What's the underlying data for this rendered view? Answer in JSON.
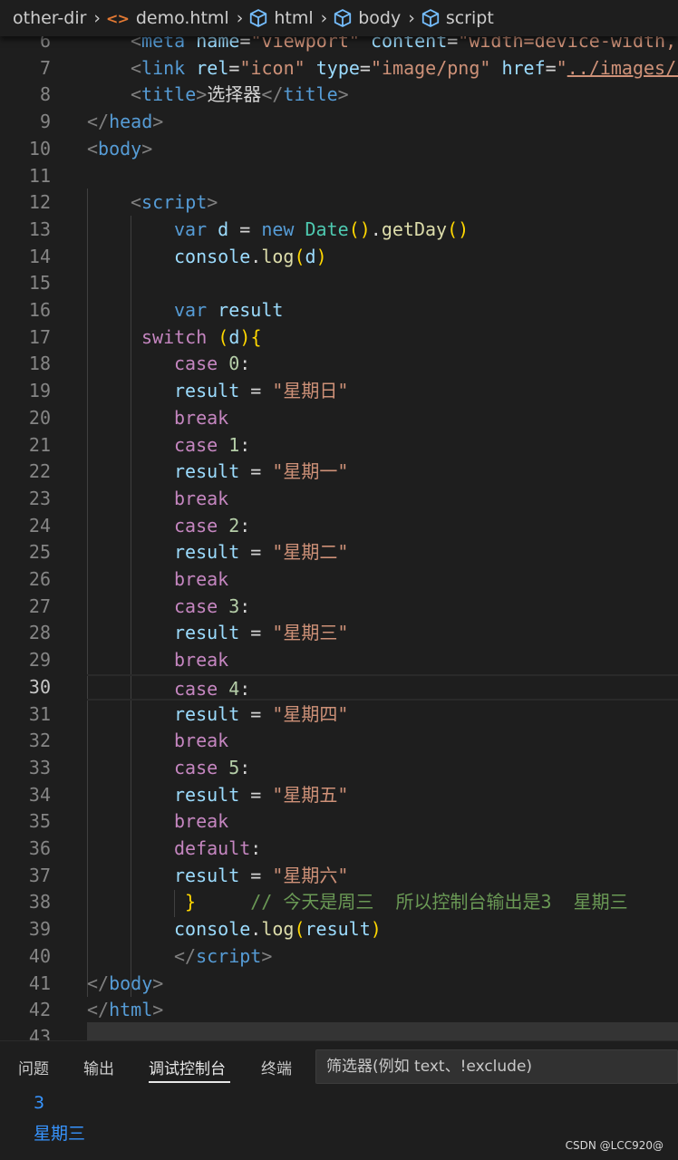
{
  "breadcrumb": {
    "items": [
      {
        "label": "other-dir",
        "icon": "none"
      },
      {
        "label": "demo.html",
        "icon": "html-file-icon"
      },
      {
        "label": "html",
        "icon": "symbol-cube-icon"
      },
      {
        "label": "body",
        "icon": "symbol-cube-icon"
      },
      {
        "label": "script",
        "icon": "symbol-cube-icon"
      }
    ]
  },
  "editor": {
    "current_line": 30,
    "lines": [
      {
        "n": "6"
      },
      {
        "n": "7"
      },
      {
        "n": "8"
      },
      {
        "n": "9"
      },
      {
        "n": "10"
      },
      {
        "n": "11"
      },
      {
        "n": "12"
      },
      {
        "n": "13"
      },
      {
        "n": "14"
      },
      {
        "n": "15"
      },
      {
        "n": "16"
      },
      {
        "n": "17"
      },
      {
        "n": "18"
      },
      {
        "n": "19"
      },
      {
        "n": "20"
      },
      {
        "n": "21"
      },
      {
        "n": "22"
      },
      {
        "n": "23"
      },
      {
        "n": "24"
      },
      {
        "n": "25"
      },
      {
        "n": "26"
      },
      {
        "n": "27"
      },
      {
        "n": "28"
      },
      {
        "n": "29"
      },
      {
        "n": "30"
      },
      {
        "n": "31"
      },
      {
        "n": "32"
      },
      {
        "n": "33"
      },
      {
        "n": "34"
      },
      {
        "n": "35"
      },
      {
        "n": "36"
      },
      {
        "n": "37"
      },
      {
        "n": "38"
      },
      {
        "n": "39"
      },
      {
        "n": "40"
      },
      {
        "n": "41"
      },
      {
        "n": "42"
      },
      {
        "n": "43"
      }
    ],
    "tokens": {
      "l6": [
        [
          "t-br",
          "<"
        ],
        [
          "t-tag",
          "meta"
        ],
        [
          "t-pl",
          " "
        ],
        [
          "t-attr",
          "name"
        ],
        [
          "t-pl",
          "="
        ],
        [
          "t-str",
          "\"viewport\""
        ],
        [
          "t-pl",
          " "
        ],
        [
          "t-attr",
          "content"
        ],
        [
          "t-pl",
          "="
        ],
        [
          "t-str",
          "\"width=device-width,"
        ]
      ],
      "l7": [
        [
          "t-br",
          "<"
        ],
        [
          "t-tag",
          "link"
        ],
        [
          "t-pl",
          " "
        ],
        [
          "t-attr",
          "rel"
        ],
        [
          "t-pl",
          "="
        ],
        [
          "t-str",
          "\"icon\""
        ],
        [
          "t-pl",
          " "
        ],
        [
          "t-attr",
          "type"
        ],
        [
          "t-pl",
          "="
        ],
        [
          "t-str",
          "\"image/png\""
        ],
        [
          "t-pl",
          " "
        ],
        [
          "t-attr",
          "href"
        ],
        [
          "t-pl",
          "="
        ],
        [
          "t-str",
          "\""
        ],
        [
          "t-link",
          "../images/i"
        ]
      ],
      "l8": [
        [
          "t-br",
          "<"
        ],
        [
          "t-tag",
          "title"
        ],
        [
          "t-br",
          ">"
        ],
        [
          "t-pl",
          "选择器"
        ],
        [
          "t-br",
          "</"
        ],
        [
          "t-tag",
          "title"
        ],
        [
          "t-br",
          ">"
        ]
      ],
      "l9": [
        [
          "t-br",
          "</"
        ],
        [
          "t-tag",
          "head"
        ],
        [
          "t-br",
          ">"
        ]
      ],
      "l10": [
        [
          "t-br",
          "<"
        ],
        [
          "t-tag",
          "body"
        ],
        [
          "t-br",
          ">"
        ]
      ],
      "l11": [],
      "l12": [
        [
          "t-br",
          "<"
        ],
        [
          "t-tag",
          "script"
        ],
        [
          "t-br",
          ">"
        ]
      ],
      "l13": [
        [
          "t-kw",
          "var"
        ],
        [
          "t-pl",
          " "
        ],
        [
          "t-var",
          "d"
        ],
        [
          "t-pl",
          " = "
        ],
        [
          "t-kw",
          "new"
        ],
        [
          "t-pl",
          " "
        ],
        [
          "t-cls",
          "Date"
        ],
        [
          "t-paren",
          "()"
        ],
        [
          "t-pl",
          "."
        ],
        [
          "t-fn",
          "getDay"
        ],
        [
          "t-paren",
          "()"
        ]
      ],
      "l14": [
        [
          "t-var",
          "console"
        ],
        [
          "t-pl",
          "."
        ],
        [
          "t-fn",
          "log"
        ],
        [
          "t-paren",
          "("
        ],
        [
          "t-var",
          "d"
        ],
        [
          "t-paren",
          ")"
        ]
      ],
      "l15": [],
      "l16": [
        [
          "t-kw",
          "var"
        ],
        [
          "t-pl",
          " "
        ],
        [
          "t-var",
          "result"
        ]
      ],
      "l17": [
        [
          "t-ctl",
          "switch"
        ],
        [
          "t-pl",
          " "
        ],
        [
          "t-paren",
          "("
        ],
        [
          "t-var",
          "d"
        ],
        [
          "t-paren",
          ")"
        ],
        [
          "t-paren",
          "{"
        ]
      ],
      "l18": [
        [
          "t-ctl",
          "case"
        ],
        [
          "t-pl",
          " "
        ],
        [
          "t-num",
          "0"
        ],
        [
          "t-pl",
          ":"
        ]
      ],
      "l19": [
        [
          "t-var",
          "result"
        ],
        [
          "t-pl",
          " = "
        ],
        [
          "t-str",
          "\"星期日\""
        ]
      ],
      "l20": [
        [
          "t-ctl",
          "break"
        ]
      ],
      "l21": [
        [
          "t-ctl",
          "case"
        ],
        [
          "t-pl",
          " "
        ],
        [
          "t-num",
          "1"
        ],
        [
          "t-pl",
          ":"
        ]
      ],
      "l22": [
        [
          "t-var",
          "result"
        ],
        [
          "t-pl",
          " = "
        ],
        [
          "t-str",
          "\"星期一\""
        ]
      ],
      "l23": [
        [
          "t-ctl",
          "break"
        ]
      ],
      "l24": [
        [
          "t-ctl",
          "case"
        ],
        [
          "t-pl",
          " "
        ],
        [
          "t-num",
          "2"
        ],
        [
          "t-pl",
          ":"
        ]
      ],
      "l25": [
        [
          "t-var",
          "result"
        ],
        [
          "t-pl",
          " = "
        ],
        [
          "t-str",
          "\"星期二\""
        ]
      ],
      "l26": [
        [
          "t-ctl",
          "break"
        ]
      ],
      "l27": [
        [
          "t-ctl",
          "case"
        ],
        [
          "t-pl",
          " "
        ],
        [
          "t-num",
          "3"
        ],
        [
          "t-pl",
          ":"
        ]
      ],
      "l28": [
        [
          "t-var",
          "result"
        ],
        [
          "t-pl",
          " = "
        ],
        [
          "t-str",
          "\"星期三\""
        ]
      ],
      "l29": [
        [
          "t-ctl",
          "break"
        ]
      ],
      "l30": [
        [
          "t-ctl",
          "case"
        ],
        [
          "t-pl",
          " "
        ],
        [
          "t-num",
          "4"
        ],
        [
          "t-pl",
          ":"
        ]
      ],
      "l31": [
        [
          "t-var",
          "result"
        ],
        [
          "t-pl",
          " = "
        ],
        [
          "t-str",
          "\"星期四\""
        ]
      ],
      "l32": [
        [
          "t-ctl",
          "break"
        ]
      ],
      "l33": [
        [
          "t-ctl",
          "case"
        ],
        [
          "t-pl",
          " "
        ],
        [
          "t-num",
          "5"
        ],
        [
          "t-pl",
          ":"
        ]
      ],
      "l34": [
        [
          "t-var",
          "result"
        ],
        [
          "t-pl",
          " = "
        ],
        [
          "t-str",
          "\"星期五\""
        ]
      ],
      "l35": [
        [
          "t-ctl",
          "break"
        ]
      ],
      "l36": [
        [
          "t-ctl",
          "default"
        ],
        [
          "t-pl",
          ":"
        ]
      ],
      "l37": [
        [
          "t-var",
          "result"
        ],
        [
          "t-pl",
          " = "
        ],
        [
          "t-str",
          "\"星期六\""
        ]
      ],
      "l38": [
        [
          "t-paren",
          "}"
        ],
        [
          "t-pl",
          "     "
        ],
        [
          "t-cmt",
          "// 今天是周三  所以控制台输出是3  星期三"
        ]
      ],
      "l39": [
        [
          "t-var",
          "console"
        ],
        [
          "t-pl",
          "."
        ],
        [
          "t-fn",
          "log"
        ],
        [
          "t-paren",
          "("
        ],
        [
          "t-var",
          "result"
        ],
        [
          "t-paren",
          ")"
        ]
      ],
      "l40": [
        [
          "t-br",
          "</"
        ],
        [
          "t-tag",
          "script"
        ],
        [
          "t-br",
          ">"
        ]
      ],
      "l41": [
        [
          "t-br",
          "</"
        ],
        [
          "t-tag",
          "body"
        ],
        [
          "t-br",
          ">"
        ]
      ],
      "l42": [
        [
          "t-br",
          "</"
        ],
        [
          "t-tag",
          "html"
        ],
        [
          "t-br",
          ">"
        ]
      ],
      "l43": []
    }
  },
  "panel": {
    "tabs": [
      "问题",
      "输出",
      "调试控制台",
      "终端"
    ],
    "active_tab": "调试控制台",
    "filter_placeholder": "筛选器(例如 text、!exclude)",
    "output": [
      "3",
      "星期三"
    ]
  },
  "watermark": "CSDN @LCC920@",
  "colors": {
    "background": "#1e1e1e",
    "keyword": "#569cd6",
    "control": "#c586c0",
    "string": "#ce9178",
    "variable": "#9cdcfe",
    "function": "#dcdcaa",
    "class": "#4ec9b0",
    "number": "#b5cea8",
    "comment": "#6a9955",
    "bracket": "#ffd700",
    "console_output": "#3794ff"
  }
}
